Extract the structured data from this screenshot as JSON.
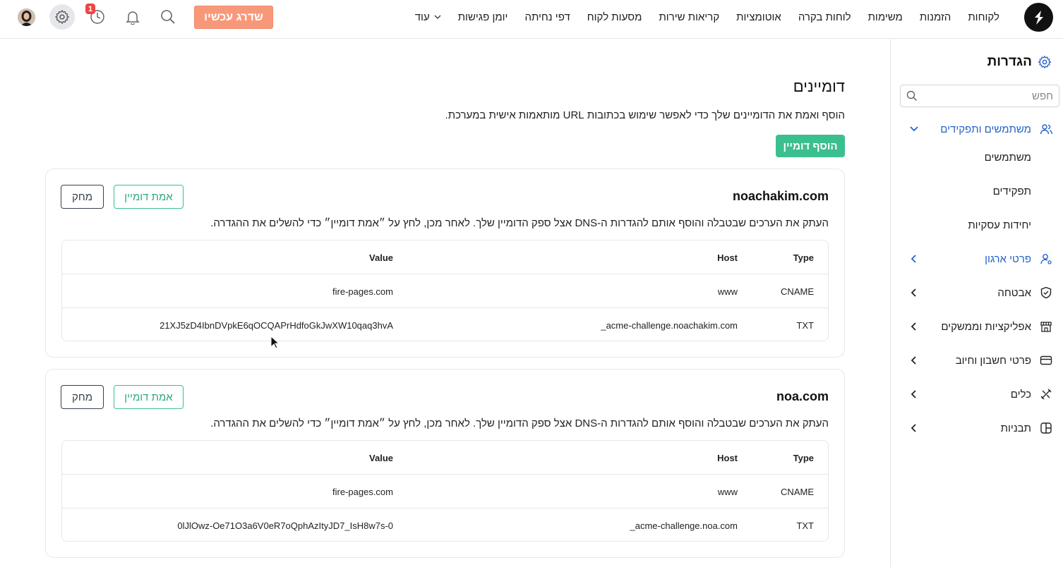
{
  "topbar": {
    "nav": [
      {
        "id": "customers",
        "label": "לקוחות"
      },
      {
        "id": "orders",
        "label": "הזמנות"
      },
      {
        "id": "tasks",
        "label": "משימות"
      },
      {
        "id": "dashboards",
        "label": "לוחות בקרה"
      },
      {
        "id": "automations",
        "label": "אוטומציות"
      },
      {
        "id": "service-calls",
        "label": "קריאות שירות"
      },
      {
        "id": "customer-journeys",
        "label": "מסעות לקוח"
      },
      {
        "id": "landing-pages",
        "label": "דפי נחיתה"
      },
      {
        "id": "meetings-calendar",
        "label": "יומן פגישות"
      }
    ],
    "more_label": "עוד",
    "upgrade_label": "שדרג עכשיו",
    "history_badge": "1",
    "colors": {
      "upgrade": "#f8987a",
      "badge": "#ef4444"
    }
  },
  "sidebar": {
    "title": "הגדרות",
    "search_placeholder": "חפש",
    "users_roles": {
      "label": "משתמשים ותפקידים",
      "items": [
        "משתמשים",
        "תפקידים",
        "יחידות עסקיות"
      ]
    },
    "sections": [
      {
        "label": "פרטי ארגון",
        "icon": "org-user-icon"
      },
      {
        "label": "אבטחה",
        "icon": "shield-icon"
      },
      {
        "label": "אפליקציות וממשקים",
        "icon": "store-icon"
      },
      {
        "label": "פרטי חשבון וחיוב",
        "icon": "credit-card-icon"
      },
      {
        "label": "כלים",
        "icon": "tools-icon"
      },
      {
        "label": "תבניות",
        "icon": "template-icon"
      }
    ]
  },
  "main": {
    "title": "דומיינים",
    "description": "הוסף ואמת את הדומיינים שלך כדי לאפשר שימוש בכתובות URL מותאמות אישית במערכת.",
    "add_button": "הוסף דומיין",
    "colors": {
      "primary": "#3cbf8e",
      "link": "#2563c9"
    },
    "table_headers": {
      "type": "Type",
      "host": "Host",
      "value": "Value"
    },
    "domains": [
      {
        "name": "noachakim.com",
        "verify_label": "אמת דומיין",
        "delete_label": "מחק",
        "instructions": "העתק את הערכים שבטבלה והוסף אותם להגדרות ה-DNS אצל ספק הדומיין שלך. לאחר מכן, לחץ על ״אמת דומיין״ כדי להשלים את ההגדרה.",
        "records": [
          {
            "type": "CNAME",
            "host": "www",
            "value": "fire-pages.com"
          },
          {
            "type": "TXT",
            "host": "_acme-challenge.noachakim.com",
            "value": "21XJ5zD4IbnDVpkE6qOCQAPrHdfoGkJwXW10qaq3hvA"
          }
        ]
      },
      {
        "name": "noa.com",
        "verify_label": "אמת דומיין",
        "delete_label": "מחק",
        "instructions": "העתק את הערכים שבטבלה והוסף אותם להגדרות ה-DNS אצל ספק הדומיין שלך. לאחר מכן, לחץ על ״אמת דומיין״ כדי להשלים את ההגדרה.",
        "records": [
          {
            "type": "CNAME",
            "host": "www",
            "value": "fire-pages.com"
          },
          {
            "type": "TXT",
            "host": "_acme-challenge.noa.com",
            "value": "0lJlOwz-Oe71O3a6V0eR7oQphAzItyJD7_IsH8w7s-0"
          }
        ]
      }
    ]
  }
}
